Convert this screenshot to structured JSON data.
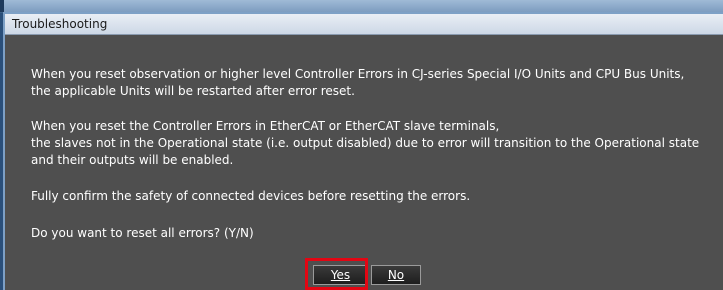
{
  "dialog": {
    "title": "Troubleshooting",
    "lines": [
      "When you reset observation or higher level Controller Errors in CJ-series Special I/O Units and CPU Bus Units,",
      "the applicable Units will be restarted after error reset.",
      "When you reset the Controller Errors in EtherCAT or EtherCAT slave terminals,",
      "the slaves not in the Operational state (i.e. output disabled) due to error will transition to the Operational state",
      "and their outputs will be enabled.",
      "Fully confirm the safety of connected devices before resetting the errors.",
      "Do you want to reset all errors? (Y/N)"
    ],
    "buttons": {
      "yes_label": "Yes",
      "no_label": "No"
    }
  },
  "colors": {
    "dialog_background": "#4f4f4f",
    "highlight_box": "#e30613"
  }
}
